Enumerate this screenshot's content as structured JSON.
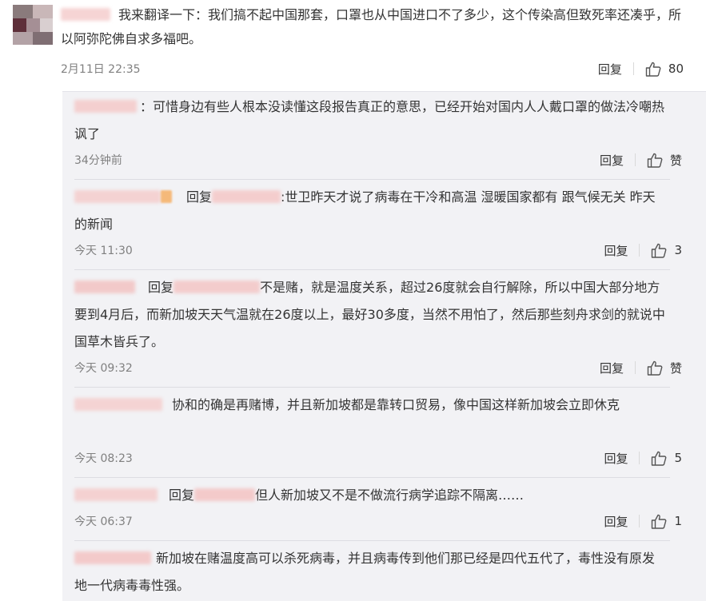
{
  "main_comment": {
    "text": "我来翻译一下：我们搞不起中国那套，口罩也从中国进口不了多少，这个传染高但致死率还凑乎，所以阿弥陀佛自求多福吧。",
    "time": "2月11日 22:35",
    "reply_label": "回复",
    "likes": "80"
  },
  "replies": [
    {
      "text": "：可惜身边有些人根本没读懂这段报告真正的意思，已经开始对国内人人戴口罩的做法冷嘲热讽了",
      "time": "34分钟前",
      "reply_label": "回复",
      "likes": "赞"
    },
    {
      "prefix": "回复",
      "text": ":世卫昨天才说了病毒在干冷和高温 湿暖国家都有 跟气候无关 昨天的新闻",
      "time": "今天 11:30",
      "reply_label": "回复",
      "likes": "3"
    },
    {
      "prefix": "回复",
      "text": "不是赌，就是温度关系，超过26度就会自行解除，所以中国大部分地方要到4月后，而新加坡天天气温就在26度以上，最好30多度，当然不用怕了，然后那些刻舟求剑的就说中国草木皆兵了。",
      "time": "今天 09:32",
      "reply_label": "回复",
      "likes": "赞"
    },
    {
      "text": "协和的确是再赌博，并且新加坡都是靠转口贸易，像中国这样新加坡会立即休克",
      "time": "今天 08:23",
      "reply_label": "回复",
      "likes": "5"
    },
    {
      "prefix": "回复",
      "text": "但人新加坡又不是不做流行病学追踪不隔离……",
      "time": "今天 06:37",
      "reply_label": "回复",
      "likes": "1"
    },
    {
      "text": "新加坡在赌温度高可以杀死病毒，并且病毒传到他们那已经是四代五代了，毒性没有原发地一代病毒毒性强。"
    }
  ],
  "icons": [
    "thumbs-up-icon",
    "avatar"
  ],
  "colors": {
    "panel_bg": "#f2f2f5",
    "meta_text": "#808080",
    "body_text": "#333333",
    "blur_pink": "#f6d0d0"
  }
}
